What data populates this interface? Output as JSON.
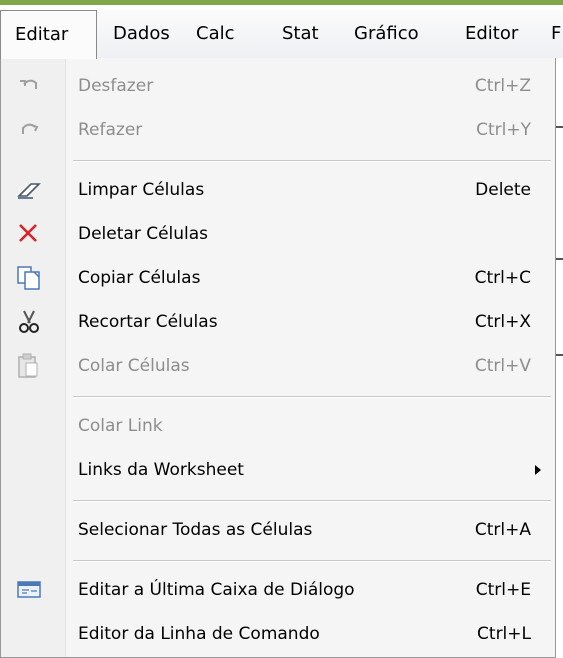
{
  "menubar": {
    "items": [
      {
        "label": "Editar"
      },
      {
        "label": "Dados"
      },
      {
        "label": "Calc"
      },
      {
        "label": "Stat"
      },
      {
        "label": "Gráfico"
      },
      {
        "label": "Editor"
      },
      {
        "label": "F"
      }
    ]
  },
  "menu": {
    "items": [
      {
        "label": "Desfazer",
        "shortcut": "Ctrl+Z",
        "icon": "undo-icon",
        "disabled": true
      },
      {
        "label": "Refazer",
        "shortcut": "Ctrl+Y",
        "icon": "redo-icon",
        "disabled": true
      },
      {
        "label": "Limpar Células",
        "shortcut": "Delete",
        "icon": "eraser-icon"
      },
      {
        "label": "Deletar Células",
        "shortcut": "",
        "icon": "delete-x-icon"
      },
      {
        "label": "Copiar Células",
        "shortcut": "Ctrl+C",
        "icon": "copy-icon"
      },
      {
        "label": "Recortar Células",
        "shortcut": "Ctrl+X",
        "icon": "scissors-icon"
      },
      {
        "label": "Colar Células",
        "shortcut": "Ctrl+V",
        "icon": "paste-icon",
        "disabled": true
      },
      {
        "label": "Colar Link",
        "shortcut": "",
        "disabled": true
      },
      {
        "label": "Links da Worksheet",
        "shortcut": "",
        "submenu": true
      },
      {
        "label": "Selecionar Todas as Células",
        "shortcut": "Ctrl+A"
      },
      {
        "label": "Editar a Última Caixa de Diálogo",
        "shortcut": "Ctrl+E",
        "icon": "dialog-box-icon"
      },
      {
        "label": "Editor da Linha de Comando",
        "shortcut": "Ctrl+L"
      }
    ]
  },
  "colors": {
    "menu_bg": "#f5f5f5",
    "disabled_text": "#8d8d8d",
    "delete_red": "#d8232a",
    "top_green": "#7fa74a"
  }
}
